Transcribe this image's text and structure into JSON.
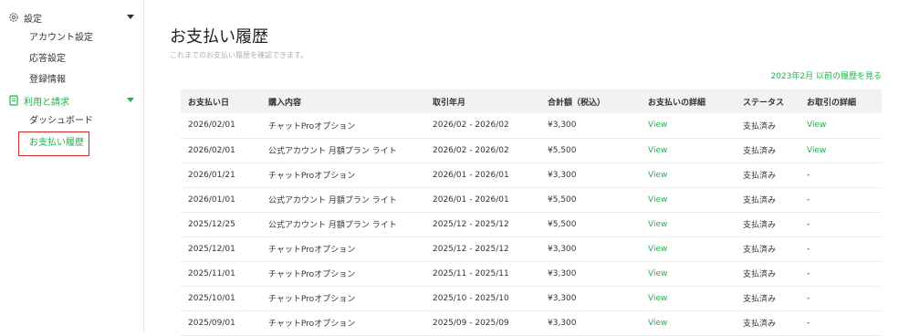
{
  "sidebar": {
    "settings": {
      "label": "設定",
      "icon": "gear-icon",
      "items": [
        "アカウント設定",
        "応答設定",
        "登録情報"
      ]
    },
    "billing": {
      "label": "利用と請求",
      "icon": "document-icon",
      "items": [
        "ダッシュボード",
        "お支払い履歴"
      ],
      "active_item": "お支払い履歴"
    }
  },
  "page": {
    "title": "お支払い履歴",
    "subtitle": "これまでのお支払い履歴を確認できます。",
    "prev_link": "2023年2月 以前の履歴を見る"
  },
  "table": {
    "headers": [
      "お支払い日",
      "購入内容",
      "取引年月",
      "合計額（税込）",
      "お支払いの詳細",
      "ステータス",
      "お取引の詳細"
    ],
    "rows": [
      [
        "2026/02/01",
        "チャットProオプション",
        "2026/02 - 2026/02",
        "¥3,300",
        "View",
        "支払済み",
        "View"
      ],
      [
        "2026/02/01",
        "公式アカウント 月額プラン ライト",
        "2026/02 - 2026/02",
        "¥5,500",
        "View",
        "支払済み",
        "View"
      ],
      [
        "2026/01/21",
        "チャットProオプション",
        "2026/01 - 2026/01",
        "¥3,300",
        "View",
        "支払済み",
        "-"
      ],
      [
        "2026/01/01",
        "公式アカウント 月額プラン ライト",
        "2026/01 - 2026/01",
        "¥5,500",
        "View",
        "支払済み",
        "-"
      ],
      [
        "2025/12/25",
        "公式アカウント 月額プラン ライト",
        "2025/12 - 2025/12",
        "¥5,500",
        "View",
        "支払済み",
        "-"
      ],
      [
        "2025/12/01",
        "チャットProオプション",
        "2025/12 - 2025/12",
        "¥3,300",
        "View",
        "支払済み",
        "-"
      ],
      [
        "2025/11/01",
        "チャットProオプション",
        "2025/11 - 2025/11",
        "¥3,300",
        "View",
        "支払済み",
        "-"
      ],
      [
        "2025/10/01",
        "チャットProオプション",
        "2025/10 - 2025/10",
        "¥3,300",
        "View",
        "支払済み",
        "-"
      ],
      [
        "2025/09/01",
        "チャットProオプション",
        "2025/09 - 2025/09",
        "¥3,300",
        "View",
        "支払済み",
        "-"
      ]
    ]
  },
  "colors": {
    "accent": "#21b14b",
    "highlight_border": "#d12b2b",
    "header_bg": "#f2f2f2"
  }
}
